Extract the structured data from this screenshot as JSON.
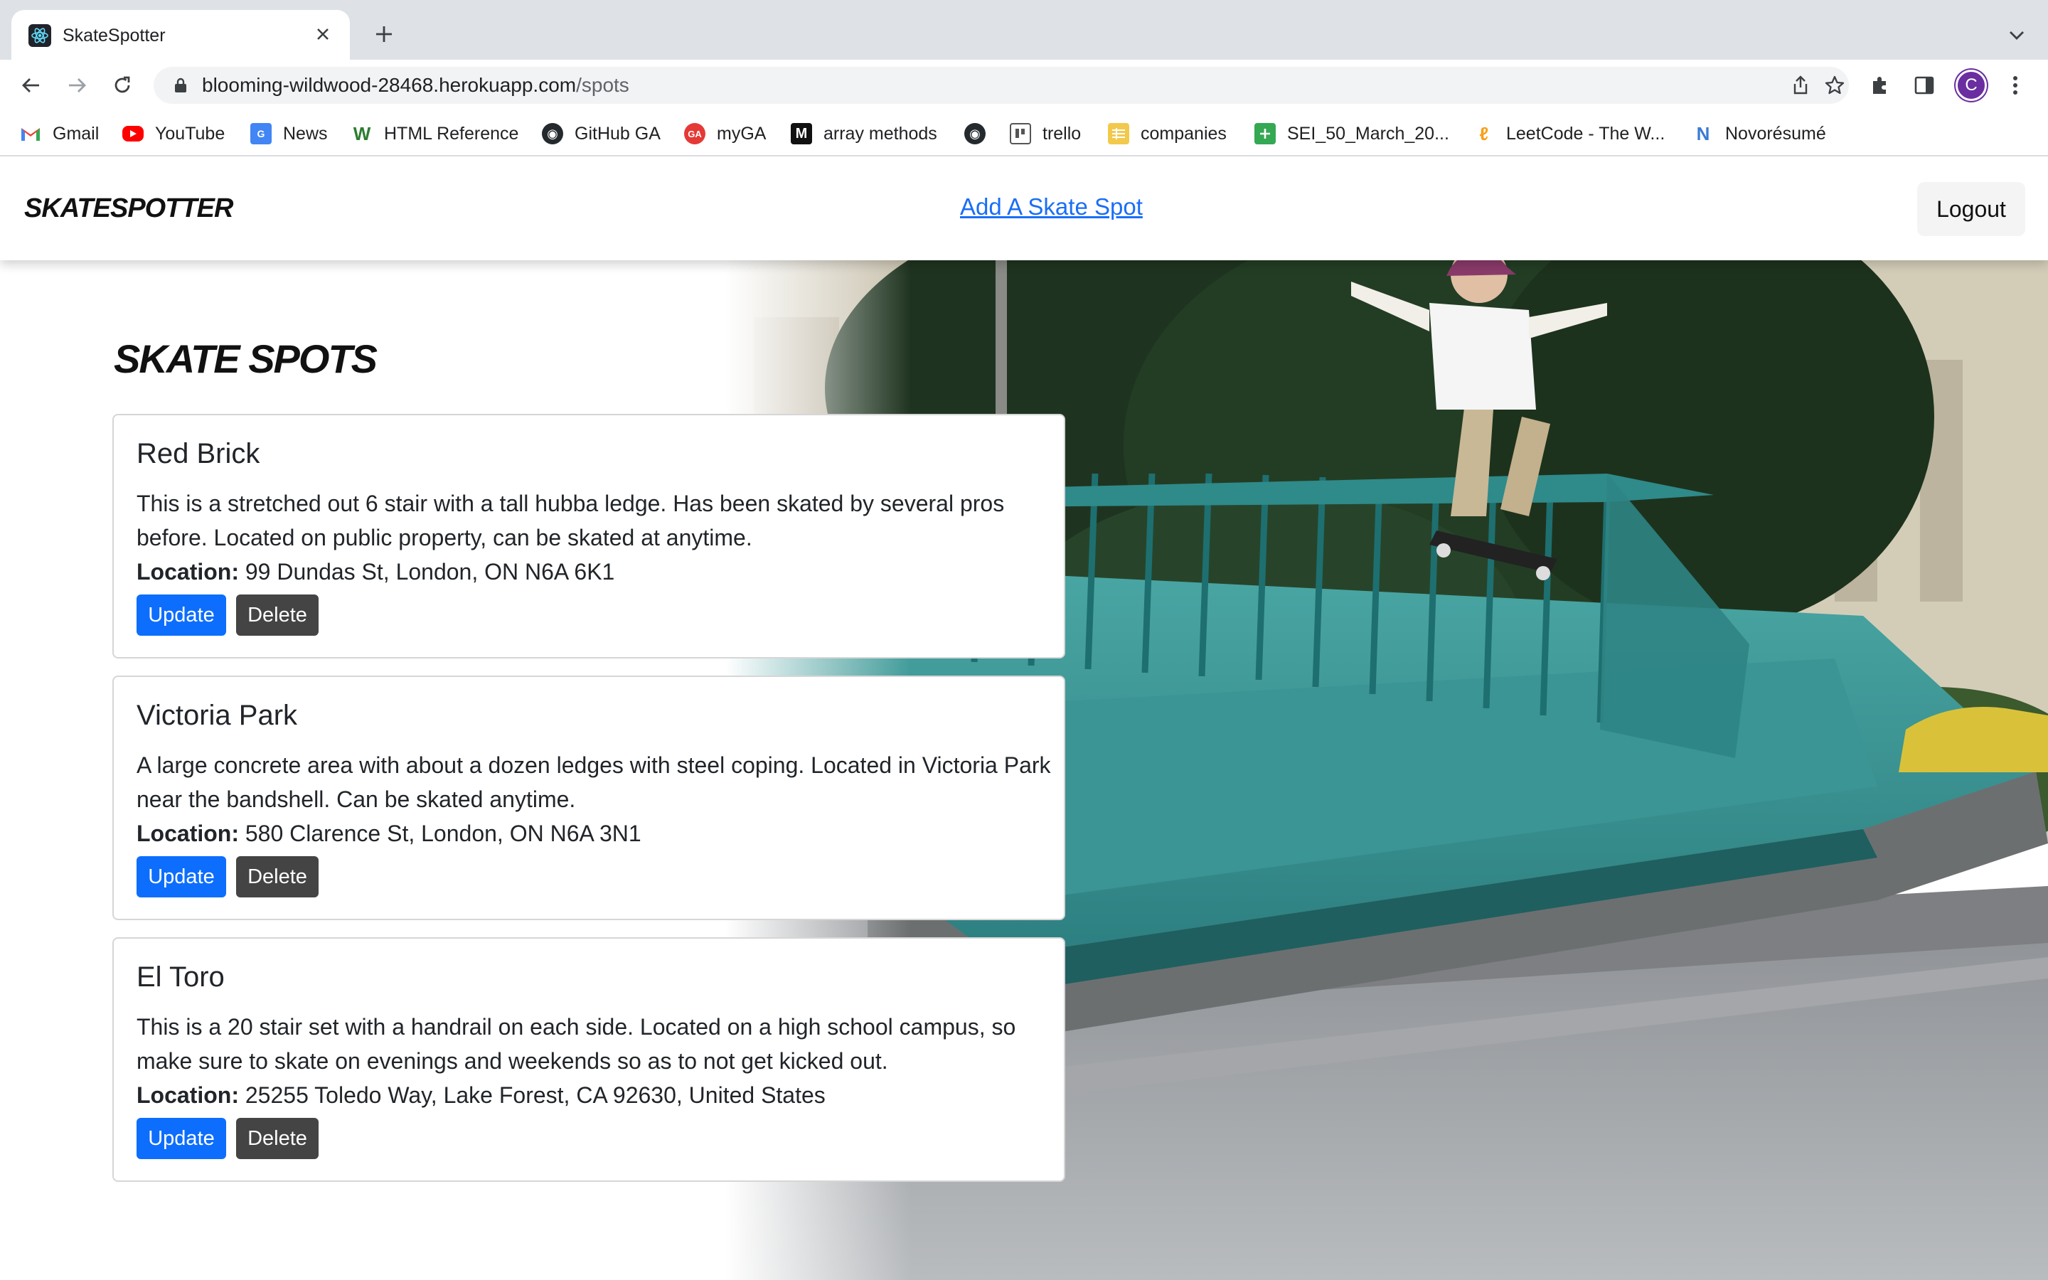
{
  "browser": {
    "tab_title": "SkateSpotter",
    "url_host": "blooming-wildwood-28468.herokuapp.com",
    "url_path": "/spots",
    "profile_initial": "C",
    "bookmarks": [
      "Gmail",
      "YouTube",
      "News",
      "HTML Reference",
      "GitHub GA",
      "myGA",
      "array methods",
      "",
      "trello",
      "companies",
      "SEI_50_March_20...",
      "LeetCode - The W...",
      "Novorésumé"
    ]
  },
  "navbar": {
    "brand": "SKATESPOTTER",
    "add_link": "Add A Skate Spot",
    "logout": "Logout"
  },
  "main": {
    "heading": "SKATE SPOTS",
    "location_label": "Location:",
    "update_label": "Update",
    "delete_label": "Delete",
    "spots": [
      {
        "name": "Red Brick",
        "description": "This is a stretched out 6 stair with a tall hubba ledge. Has been skated by several pros before. Located on public property, can be skated at anytime.",
        "location": "99 Dundas St, London, ON N6A 6K1"
      },
      {
        "name": "Victoria Park",
        "description": "A large concrete area with about a dozen ledges with steel coping. Located in Victoria Park near the bandshell. Can be skated anytime.",
        "location": "580 Clarence St, London, ON N6A 3N1"
      },
      {
        "name": "El Toro",
        "description": "This is a 20 stair set with a handrail on each side. Located on a high school campus, so make sure to skate on evenings and weekends so as to not get kicked out.",
        "location": "25255 Toledo Way, Lake Forest, CA 92630, United States"
      }
    ]
  },
  "colors": {
    "link": "#1a6ef5",
    "update_button": "#0d6efd",
    "delete_button": "#444444",
    "rail_teal": "#2f8a8a"
  }
}
